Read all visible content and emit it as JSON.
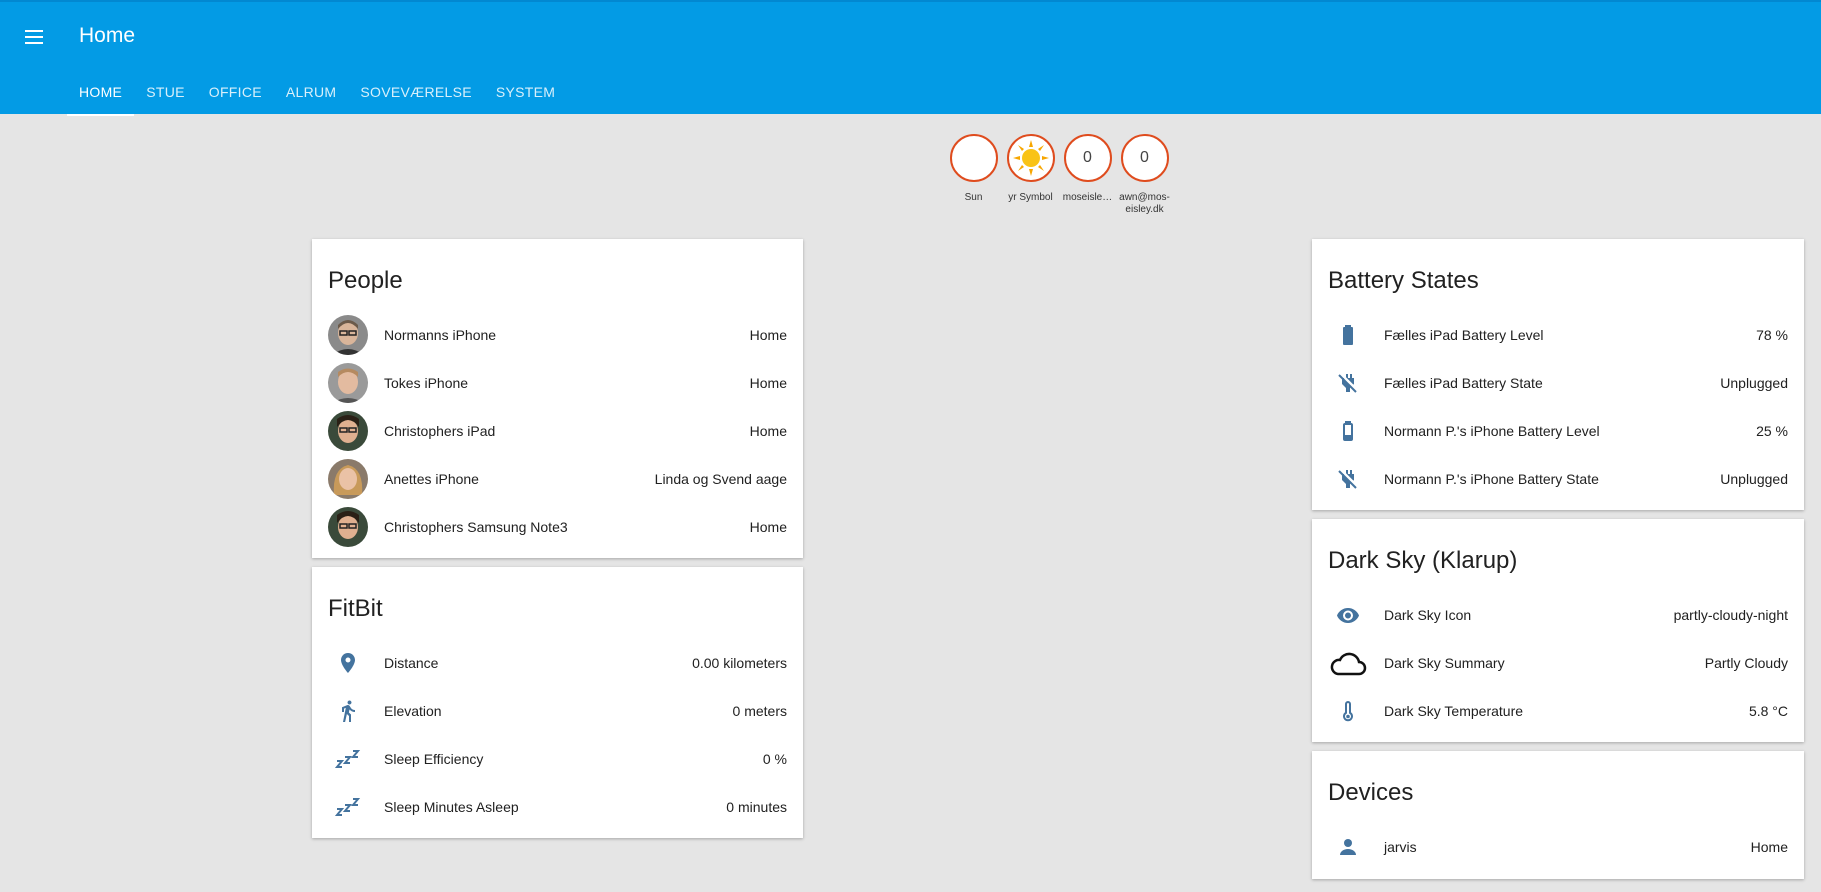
{
  "appbar": {
    "title": "Home",
    "menu_icon": "menu-icon"
  },
  "tabs": [
    "HOME",
    "STUE",
    "OFFICE",
    "ALRUM",
    "SOVEVÆRELSE",
    "SYSTEM"
  ],
  "badges": [
    {
      "label": "Sun",
      "icon": "moon-icon"
    },
    {
      "label": "yr Symbol",
      "icon": "sun-icon"
    },
    {
      "label": "moseisle…",
      "value": "0"
    },
    {
      "label": "awn@mos-eisley.dk",
      "value": "0"
    }
  ],
  "people": {
    "title": "People",
    "items": [
      {
        "name": "Normanns iPhone",
        "state": "Home"
      },
      {
        "name": "Tokes iPhone",
        "state": "Home"
      },
      {
        "name": "Christophers iPad",
        "state": "Home"
      },
      {
        "name": "Anettes iPhone",
        "state": "Linda og Svend aage"
      },
      {
        "name": "Christophers Samsung Note3",
        "state": "Home"
      }
    ]
  },
  "fitbit": {
    "title": "FitBit",
    "items": [
      {
        "name": "Distance",
        "state": "0.00 kilometers",
        "icon": "map-marker-icon"
      },
      {
        "name": "Elevation",
        "state": "0 meters",
        "icon": "walk-icon"
      },
      {
        "name": "Sleep Efficiency",
        "state": "0 %",
        "icon": "sleep-icon"
      },
      {
        "name": "Sleep Minutes Asleep",
        "state": "0 minutes",
        "icon": "sleep-icon"
      }
    ]
  },
  "battery": {
    "title": "Battery States",
    "items": [
      {
        "name": "Fælles iPad Battery Level",
        "state": "78 %",
        "icon": "battery-icon",
        "level": 0.78
      },
      {
        "name": "Fælles iPad Battery State",
        "state": "Unplugged",
        "icon": "power-plug-off-icon"
      },
      {
        "name": "Normann P.'s iPhone Battery Level",
        "state": "25 %",
        "icon": "battery-icon",
        "level": 0.25
      },
      {
        "name": "Normann P.'s iPhone Battery State",
        "state": "Unplugged",
        "icon": "power-plug-off-icon"
      }
    ]
  },
  "darksky": {
    "title": "Dark Sky (Klarup)",
    "items": [
      {
        "name": "Dark Sky Icon",
        "state": "partly-cloudy-night",
        "icon": "eye-icon"
      },
      {
        "name": "Dark Sky Summary",
        "state": "Partly Cloudy",
        "icon": "cloud-icon"
      },
      {
        "name": "Dark Sky Temperature",
        "state": "5.8 °C",
        "icon": "thermometer-icon"
      }
    ]
  },
  "devices": {
    "title": "Devices",
    "items": [
      {
        "name": "jarvis",
        "state": "Home",
        "icon": "account-icon"
      }
    ]
  },
  "colors": {
    "header": "#039be5",
    "icon": "#44739e",
    "badge_border": "#df4c1e",
    "background": "#e5e5e5"
  }
}
